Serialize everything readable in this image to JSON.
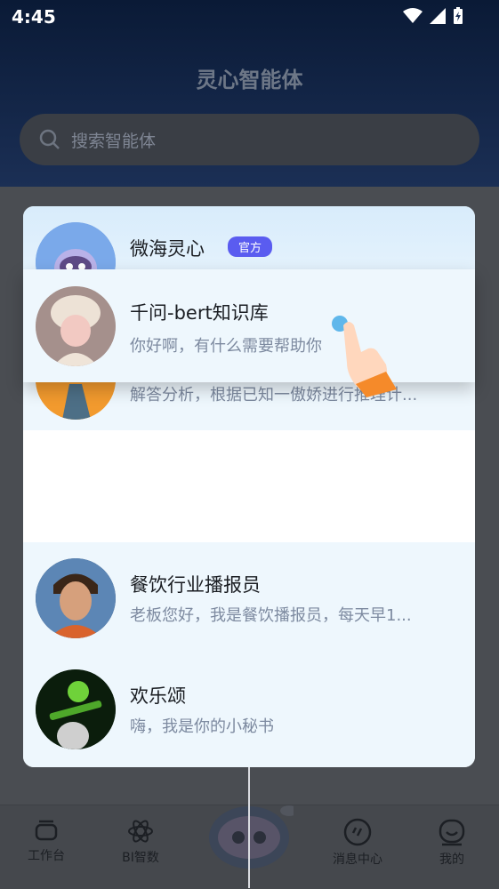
{
  "status": {
    "time": "4:45"
  },
  "app": {
    "title": "灵心智能体",
    "search_placeholder": "搜索智能体"
  },
  "agents": [
    {
      "name": "微海灵心",
      "badge": "官方",
      "desc": ""
    },
    {
      "name": "千问-bert知识库",
      "desc": "你好啊，有什么需要帮助你"
    },
    {
      "name": "",
      "desc": "解答分析，根据已知一傲娇进行推理计..."
    },
    {
      "name": "餐饮行业播报员",
      "desc": "老板您好，我是餐饮播报员，每天早1..."
    },
    {
      "name": "欢乐颂",
      "desc": "嗨，我是你的小秘书"
    }
  ],
  "tabs": [
    {
      "label": "工作台",
      "icon": "workbench-icon"
    },
    {
      "label": "BI智数",
      "icon": "atom-icon"
    },
    {
      "label": "消息中心",
      "icon": "message-icon"
    },
    {
      "label": "我的",
      "icon": "profile-icon"
    }
  ],
  "colors": {
    "accent": "#5a5cf0",
    "card_bg": "#eef7fd"
  }
}
